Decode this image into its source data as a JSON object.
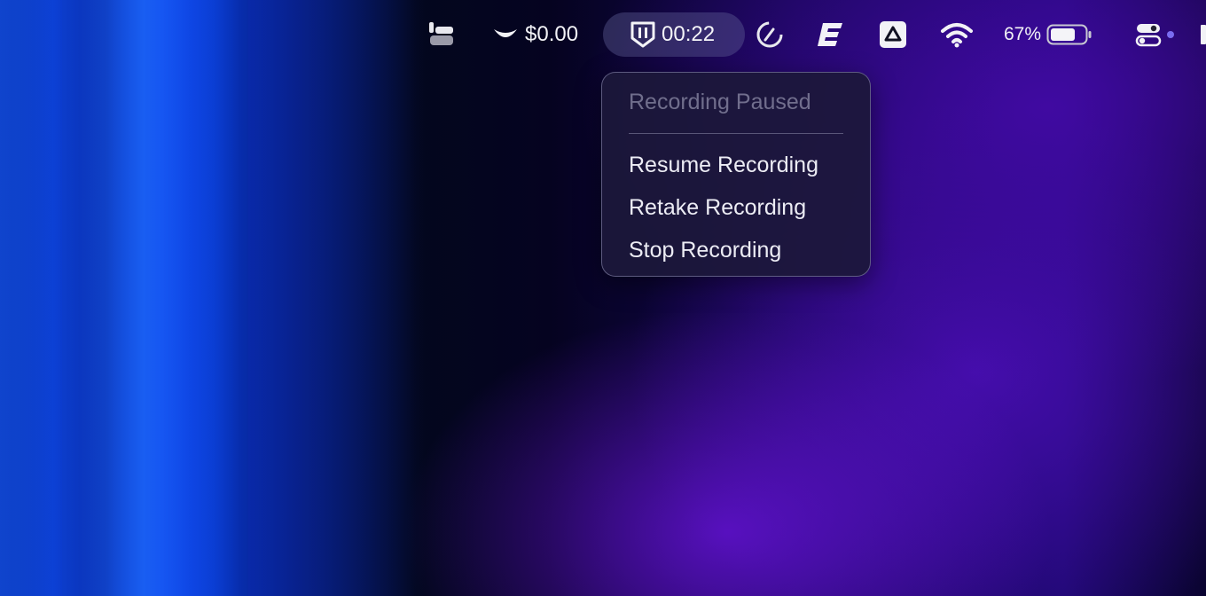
{
  "menubar": {
    "cost_text": "$0.00",
    "recorder_timer": "00:22",
    "battery_percent": "67%",
    "icons": [
      "window-manager-icon",
      "smile-icon",
      "recorder-logo-icon",
      "sync-icon",
      "bold-e-icon",
      "drive-icon",
      "wifi-icon",
      "battery-icon",
      "control-center-icon",
      "status-dot-icon"
    ]
  },
  "dropdown": {
    "header": "Recording Paused",
    "items": [
      {
        "label": "Resume Recording"
      },
      {
        "label": "Retake Recording"
      },
      {
        "label": "Stop Recording"
      }
    ]
  },
  "colors": {
    "menu_bg": "#1c183a",
    "pill_bg": "#5f5f96",
    "accent_dot": "#7a6cf0",
    "text": "#ececf4"
  }
}
